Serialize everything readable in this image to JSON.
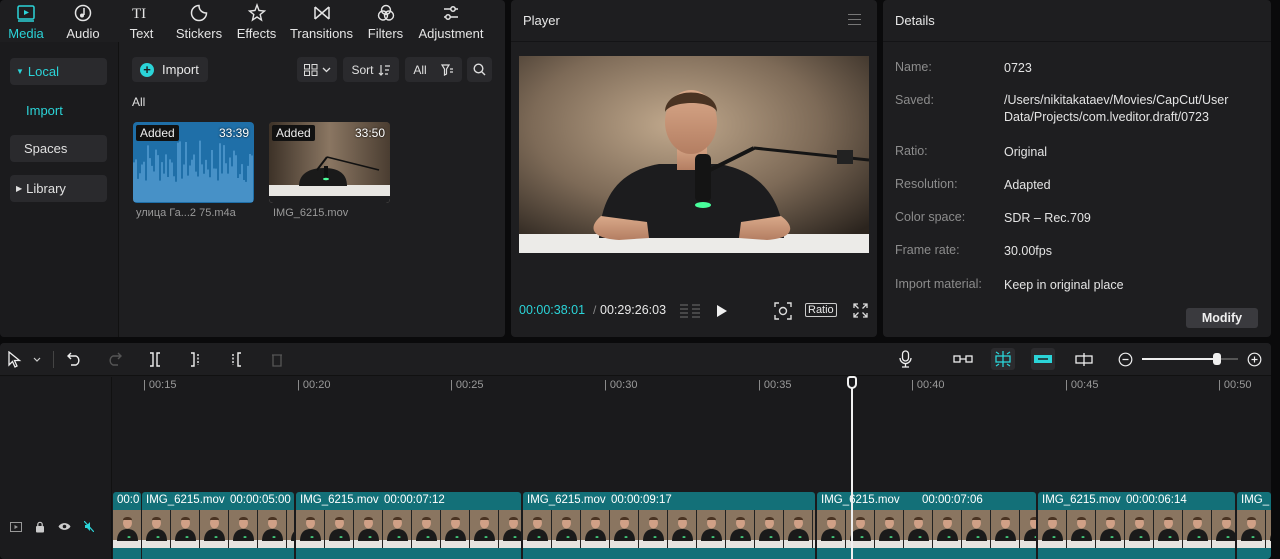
{
  "nav": {
    "tabs": [
      {
        "label": "Media",
        "icon": "media-icon"
      },
      {
        "label": "Audio",
        "icon": "audio-icon"
      },
      {
        "label": "Text",
        "icon": "text-icon"
      },
      {
        "label": "Stickers",
        "icon": "stickers-icon"
      },
      {
        "label": "Effects",
        "icon": "effects-icon"
      },
      {
        "label": "Transitions",
        "icon": "transitions-icon"
      },
      {
        "label": "Filters",
        "icon": "filters-icon"
      },
      {
        "label": "Adjustment",
        "icon": "adjustment-icon"
      }
    ],
    "active": "Media"
  },
  "sidebar": {
    "local": "Local",
    "import": "Import",
    "spaces": "Spaces",
    "library": "Library"
  },
  "media": {
    "import_label": "Import",
    "sort_label": "Sort",
    "filter_label": "All",
    "section_label": "All",
    "items": [
      {
        "badge": "Added",
        "duration": "33:39",
        "name": "улица Га...2 75.m4a",
        "kind": "audio"
      },
      {
        "badge": "Added",
        "duration": "33:50",
        "name": "IMG_6215.mov",
        "kind": "video"
      }
    ]
  },
  "player": {
    "title": "Player",
    "current_time": "00:00:38:01",
    "separator": "/",
    "total_time": "00:29:26:03",
    "ratio_label": "Ratio"
  },
  "details": {
    "title": "Details",
    "rows": [
      {
        "key": "Name:",
        "value": "0723"
      },
      {
        "key": "Saved:",
        "value": "/Users/nikitakataev/Movies/CapCut/User Data/Projects/com.lveditor.draft/0723"
      },
      {
        "key": "Ratio:",
        "value": "Original"
      },
      {
        "key": "Resolution:",
        "value": "Adapted"
      },
      {
        "key": "Color space:",
        "value": "SDR – Rec.709"
      },
      {
        "key": "Frame rate:",
        "value": "30.00fps"
      },
      {
        "key": "Import material:",
        "value": "Keep in original place"
      }
    ],
    "modify_label": "Modify"
  },
  "timeline": {
    "ticks": [
      "| 00:15",
      "| 00:20",
      "| 00:25",
      "| 00:30",
      "| 00:35",
      "| 00:40",
      "| 00:45",
      "| 00:50"
    ],
    "zoom_level": 0.78,
    "clips": [
      {
        "name": "00:0",
        "duration": ""
      },
      {
        "name": "IMG_6215.mov",
        "duration": "00:00:05:00"
      },
      {
        "name": "IMG_6215.mov",
        "duration": "00:00:07:12"
      },
      {
        "name": "IMG_6215.mov",
        "duration": "00:00:09:17"
      },
      {
        "name": "IMG_6215.mov",
        "duration": "00:00:07:06"
      },
      {
        "name": "IMG_6215.mov",
        "duration": "00:00:06:14"
      },
      {
        "name": "IMG_",
        "duration": ""
      }
    ]
  },
  "colors": {
    "accent": "#2bd4d8",
    "clip": "#137078",
    "panel": "#1e1e20"
  }
}
